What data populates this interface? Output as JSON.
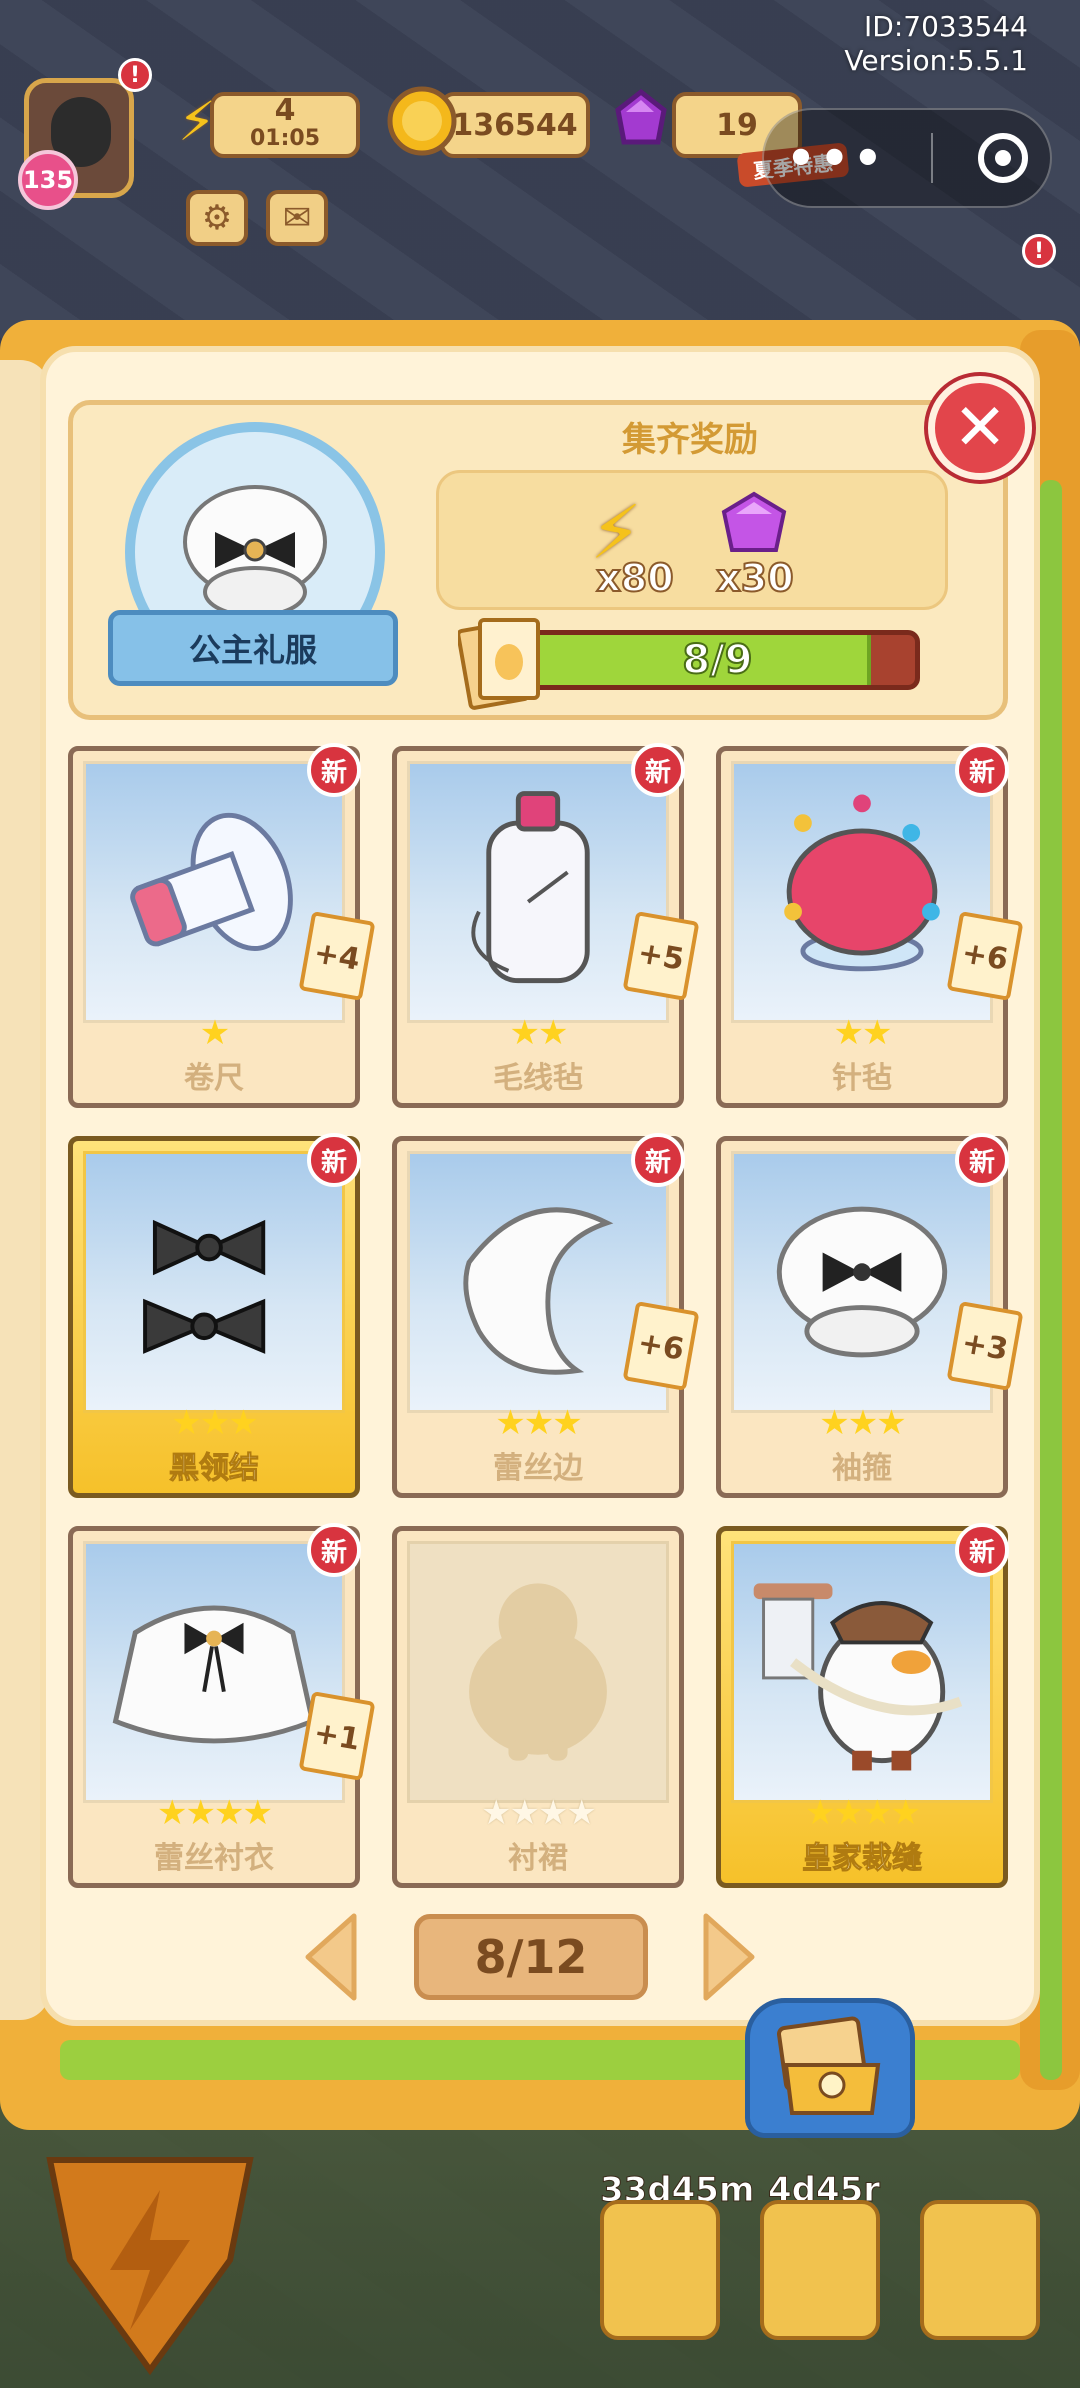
{
  "hud": {
    "id_text": "ID:7033544",
    "version_text": "Version:5.5.1",
    "level": "135",
    "energy_value": "4",
    "energy_timer": "01:05",
    "coins": "136544",
    "gems": "19",
    "gem_tag": "夏季特惠",
    "capsule_dots": "•••",
    "alert": "!"
  },
  "collection": {
    "name": "公主礼服",
    "reward_title": "集齐奖励",
    "rewards": [
      {
        "icon": "lightning-icon",
        "count": "x80",
        "color": "#f5c21b"
      },
      {
        "icon": "gem-icon",
        "count": "x30",
        "color": "#c455e6"
      }
    ],
    "progress_text": "8/9",
    "progress_fraction": 0.889
  },
  "cards": [
    {
      "name": "卷尺",
      "stars": "★",
      "max_stars": 1,
      "plus": "+4",
      "new": "新",
      "gold": false,
      "owned": true,
      "art": "tape-measure"
    },
    {
      "name": "毛线毡",
      "stars": "★★",
      "max_stars": 2,
      "plus": "+5",
      "new": "新",
      "gold": false,
      "owned": true,
      "art": "thread-spool"
    },
    {
      "name": "针毡",
      "stars": "★★",
      "max_stars": 2,
      "plus": "+6",
      "new": "新",
      "gold": false,
      "owned": true,
      "art": "pin-cushion"
    },
    {
      "name": "黑领结",
      "stars": "★★★",
      "max_stars": 3,
      "plus": "",
      "new": "新",
      "gold": true,
      "owned": true,
      "art": "bow-ties"
    },
    {
      "name": "蕾丝边",
      "stars": "★★★",
      "max_stars": 3,
      "plus": "+6",
      "new": "新",
      "gold": false,
      "owned": true,
      "art": "lace-trim"
    },
    {
      "name": "袖箍",
      "stars": "★★★",
      "max_stars": 3,
      "plus": "+3",
      "new": "新",
      "gold": false,
      "owned": true,
      "art": "armband"
    },
    {
      "name": "蕾丝衬衣",
      "stars": "★★★★",
      "max_stars": 4,
      "plus": "+1",
      "new": "新",
      "gold": false,
      "owned": true,
      "art": "lace-blouse"
    },
    {
      "name": "衬裙",
      "stars": "★★★★",
      "max_stars": 4,
      "plus": "",
      "new": "",
      "gold": false,
      "owned": false,
      "art": "silhouette"
    },
    {
      "name": "皇家裁缝",
      "stars": "★★★★",
      "max_stars": 4,
      "plus": "",
      "new": "新",
      "gold": true,
      "owned": true,
      "art": "royal-tailor"
    }
  ],
  "pager": {
    "page_text": "8/12"
  },
  "bottom": {
    "timer_a": "33d45m",
    "timer_b": "4d45r"
  }
}
